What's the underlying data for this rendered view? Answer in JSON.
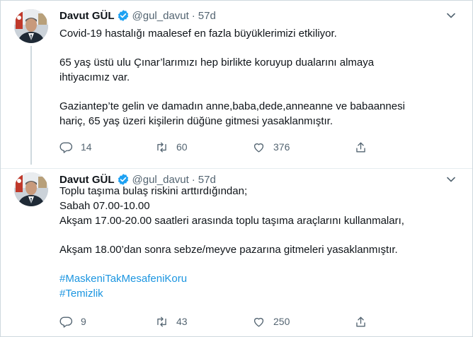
{
  "tweets": [
    {
      "name": "Davut GÜL",
      "handle": "@gul_davut",
      "separator": "·",
      "time": "57d",
      "lines": [
        "Covid-19 hastalığı maalesef en fazla büyüklerimizi etkiliyor.",
        "",
        "65 yaş üstü ulu Çınar’larımızı hep birlikte koruyup dualarını almaya",
        "ihtiyacımız var.",
        "",
        "Gaziantep’te gelin ve damadın anne,baba,dede,anneanne ve babaannesi",
        "hariç, 65 yaş üzeri kişilerin düğüne gitmesi yasaklanmıştır."
      ],
      "replies": "14",
      "retweets": "60",
      "likes": "376"
    },
    {
      "name": "Davut GÜL",
      "handle": "@gul_davut",
      "separator": "·",
      "time": "57d",
      "lines": [
        "Toplu taşıma bulaş riskini arttırdığından;",
        "Sabah 07.00-10.00",
        "Akşam 17.00-20.00 saatleri arasında toplu taşıma araçlarını kullanmaları,",
        "",
        "Akşam 18.00’dan sonra sebze/meyve pazarına gitmeleri yasaklanmıştır.",
        ""
      ],
      "hashtags": [
        "#MaskeniTakMesafeniKoru",
        "#Temizlik"
      ],
      "replies": "9",
      "retweets": "43",
      "likes": "250"
    }
  ],
  "icons": {
    "verified": "verified-badge-icon",
    "more": "chevron-down-icon",
    "reply": "reply-icon",
    "retweet": "retweet-icon",
    "like": "heart-icon",
    "share": "share-icon"
  },
  "colors": {
    "accent": "#1da1f2",
    "hashtag": "#1b95e0",
    "secondary_text": "#536471",
    "primary_text": "#0f1419"
  }
}
